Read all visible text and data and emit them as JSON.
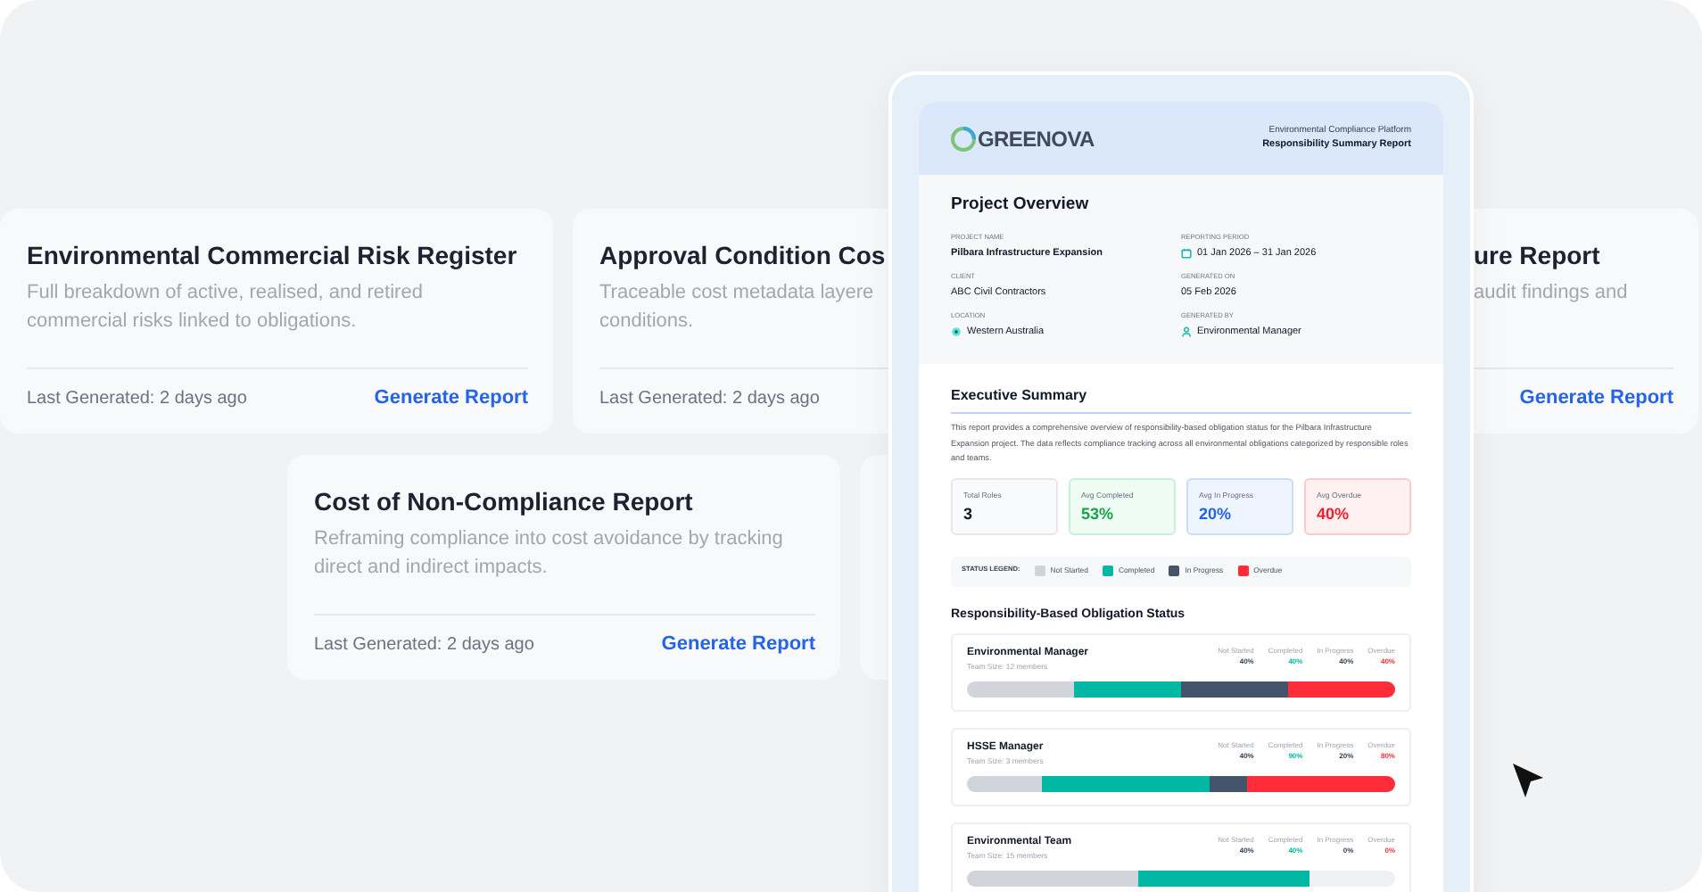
{
  "report_cards": [
    {
      "title": "Environmental Commercial Risk Register",
      "description_lines": [
        "Full breakdown of active, realised, and retired",
        "commercial risks linked to obligations."
      ],
      "last_generated": "Last Generated: 2 days ago",
      "action": "Generate Report"
    },
    {
      "title": "Approval Condition Cos",
      "description_lines": [
        "Traceable cost metadata layere",
        "conditions."
      ],
      "last_generated": "Last Generated: 2 days ago"
    },
    {
      "title": "ure Report",
      "description_lines": [
        "audit findings and"
      ],
      "action": "Generate Report"
    },
    {
      "title": "Cost of Non-Compliance Report",
      "description_lines": [
        "Reframing compliance into cost avoidance by tracking",
        "direct and indirect impacts."
      ],
      "last_generated": "Last Generated: 2 days ago",
      "action": "Generate Report"
    }
  ],
  "report_preview": {
    "brand": "GREENOVA",
    "platform": "Environmental Compliance Platform",
    "report_title": "Responsibility Summary Report",
    "overview_title": "Project Overview",
    "fields": [
      {
        "label": "PROJECT NAME",
        "value": "Pilbara Infrastructure Expansion",
        "kind": "bold"
      },
      {
        "label": "REPORTING PERIOD",
        "value": "01 Jan 2026 – 31 Jan 2026",
        "kind": "calendar"
      },
      {
        "label": "CLIENT",
        "value": "ABC Civil Contractors",
        "kind": "plain"
      },
      {
        "label": "GENERATED ON",
        "value": "05 Feb 2026",
        "kind": "plain"
      },
      {
        "label": "LOCATION",
        "value": "Western Australia",
        "kind": "pin"
      },
      {
        "label": "GENERATED BY",
        "value": "Environmental Manager",
        "kind": "person"
      }
    ],
    "summary_title": "Executive Summary",
    "summary_text": "This report provides a comprehensive overview of responsibility-based obligation status for the Pilbara Infrastructure Expansion project. The data reflects compliance tracking across all environmental obligations categorized by responsible roles and teams.",
    "stats": [
      {
        "label": "Total Roles",
        "value": "3",
        "kind": "neutral"
      },
      {
        "label": "Avg Completed",
        "value": "53%",
        "kind": "green"
      },
      {
        "label": "Avg In Progress",
        "value": "20%",
        "kind": "blue"
      },
      {
        "label": "Avg Overdue",
        "value": "40%",
        "kind": "red"
      }
    ],
    "legend_title": "STATUS LEGEND:",
    "legend": [
      {
        "label": "Not Started",
        "color": "#d1d5db"
      },
      {
        "label": "Completed",
        "color": "#00b8a3"
      },
      {
        "label": "In Progress",
        "color": "#44546a"
      },
      {
        "label": "Overdue",
        "color": "#ff2d3a"
      }
    ],
    "status_title": "Responsibility-Based Obligation Status",
    "roles": [
      {
        "name": "Environmental Manager",
        "team": "Team Size: 12 members",
        "segments": [
          {
            "label": "Not Started",
            "value": "40%",
            "kind": "not_started"
          },
          {
            "label": "Completed",
            "value": "40%",
            "kind": "completed"
          },
          {
            "label": "In Progress",
            "value": "40%",
            "kind": "in_progress"
          },
          {
            "label": "Overdue",
            "value": "40%",
            "kind": "overdue"
          }
        ]
      },
      {
        "name": "HSSE Manager",
        "team": "Team Size: 3 members",
        "segments": [
          {
            "label": "Not Started",
            "value": "40%",
            "kind": "not_started"
          },
          {
            "label": "Completed",
            "value": "90%",
            "kind": "completed"
          },
          {
            "label": "In Progress",
            "value": "20%",
            "kind": "in_progress"
          },
          {
            "label": "Overdue",
            "value": "80%",
            "kind": "overdue"
          }
        ]
      },
      {
        "name": "Environmental Team",
        "team": "Team Size: 15 members",
        "segments": [
          {
            "label": "Not Started",
            "value": "40%",
            "kind": "not_started"
          },
          {
            "label": "Completed",
            "value": "40%",
            "kind": "completed"
          },
          {
            "label": "In Progress",
            "value": "0%",
            "kind": "in_progress"
          },
          {
            "label": "Overdue",
            "value": "0%",
            "kind": "overdue"
          }
        ]
      }
    ]
  }
}
